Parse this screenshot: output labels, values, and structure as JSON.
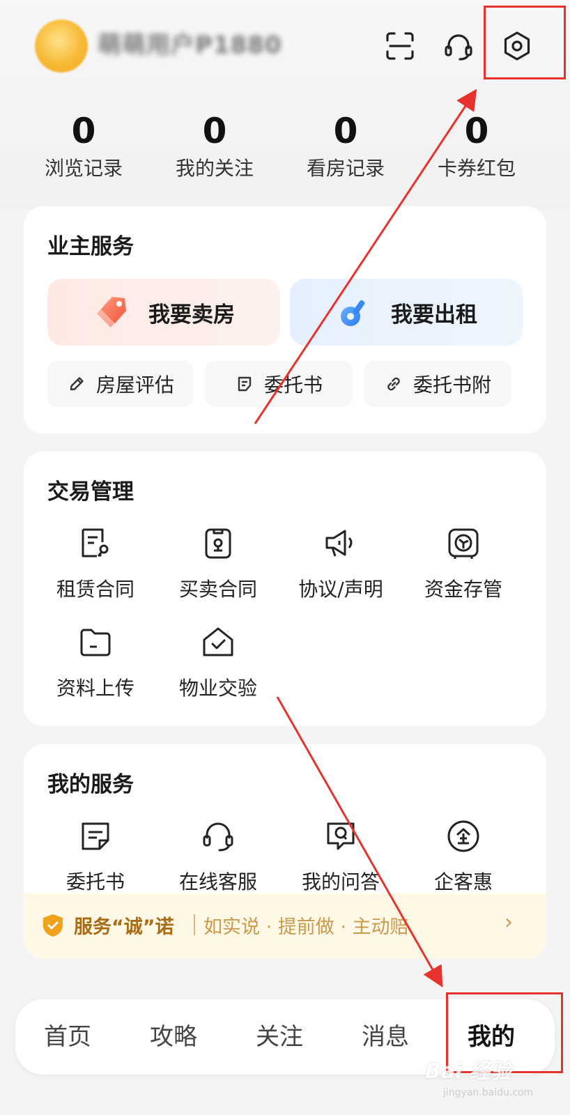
{
  "header": {
    "username": "萌萌用户P1880",
    "icons": [
      "scan-icon",
      "customer-service-icon",
      "settings-icon"
    ]
  },
  "stats": [
    {
      "value": "0",
      "label": "浏览记录"
    },
    {
      "value": "0",
      "label": "我的关注"
    },
    {
      "value": "0",
      "label": "看房记录"
    },
    {
      "value": "0",
      "label": "卡券红包"
    }
  ],
  "owner_services": {
    "title": "业主服务",
    "sell_label": "我要卖房",
    "rent_label": "我要出租",
    "small": [
      {
        "label": "房屋评估",
        "icon": "pencil-icon"
      },
      {
        "label": "委托书",
        "icon": "document-icon"
      },
      {
        "label": "委托书附",
        "icon": "link-icon"
      }
    ]
  },
  "transactions": {
    "title": "交易管理",
    "items": [
      {
        "label": "租赁合同",
        "icon": "lease-contract-icon"
      },
      {
        "label": "买卖合同",
        "icon": "sale-contract-icon"
      },
      {
        "label": "协议/声明",
        "icon": "megaphone-icon"
      },
      {
        "label": "资金存管",
        "icon": "safe-icon"
      },
      {
        "label": "资料上传",
        "icon": "folder-icon"
      },
      {
        "label": "物业交验",
        "icon": "house-check-icon"
      }
    ]
  },
  "my_services": {
    "title": "我的服务",
    "items": [
      {
        "label": "委托书",
        "icon": "document-icon"
      },
      {
        "label": "在线客服",
        "icon": "headset-icon"
      },
      {
        "label": "我的问答",
        "icon": "qa-icon"
      },
      {
        "label": "企客惠",
        "icon": "enterprise-icon"
      }
    ],
    "promise_title": "服务“诚”诺",
    "promise_text": "如实说 · 提前做 · 主动赔",
    "promise_chevron": "›"
  },
  "tabbar": {
    "tabs": [
      {
        "label": "首页"
      },
      {
        "label": "攻略"
      },
      {
        "label": "关注"
      },
      {
        "label": "消息"
      },
      {
        "label": "我的"
      }
    ],
    "active_index": 4
  },
  "watermark": {
    "text": "Bai 经验",
    "sub": "jingyan.baidu.com"
  },
  "colors": {
    "annotation": "#e8322c",
    "promise_accent": "#a86d14",
    "sell_bg": "#fdeeea",
    "rent_bg": "#eaf3fd"
  }
}
